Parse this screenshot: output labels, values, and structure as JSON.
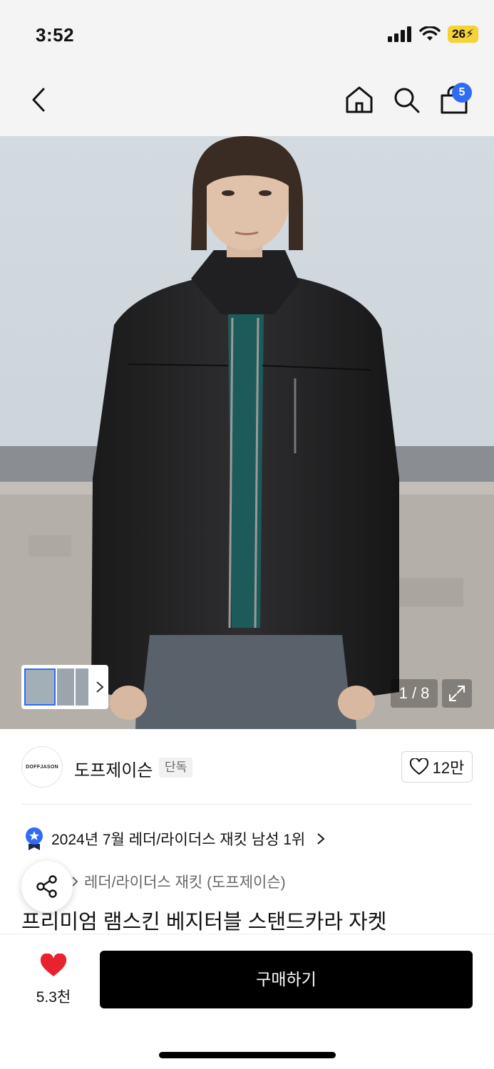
{
  "status_bar": {
    "time": "3:52",
    "battery": "26"
  },
  "nav": {
    "cart_badge": "5"
  },
  "gallery": {
    "counter": "1 / 8"
  },
  "brand": {
    "logo_text": "DOFFJASON",
    "name": "도프제이슨",
    "tag": "단독",
    "likes": "12만"
  },
  "rank": {
    "text": "2024년 7월 레더/라이더스 재킷 남성 1위"
  },
  "category": {
    "text": "레더/라이더스 재킷 (도프제이슨)"
  },
  "product": {
    "title": "프리미엄 램스킨 베지터블 스탠드카라 자켓"
  },
  "bottom": {
    "wish_count": "5.3천",
    "buy_label": "구매하기"
  },
  "colors": {
    "accent": "#2f6bf5",
    "heart": "#e8232f",
    "buy_bg": "#000000"
  },
  "icons": [
    "back-icon",
    "home-icon",
    "search-icon",
    "bag-icon",
    "expand-icon",
    "share-icon",
    "heart-icon",
    "medal-icon",
    "chevron-right-icon"
  ]
}
